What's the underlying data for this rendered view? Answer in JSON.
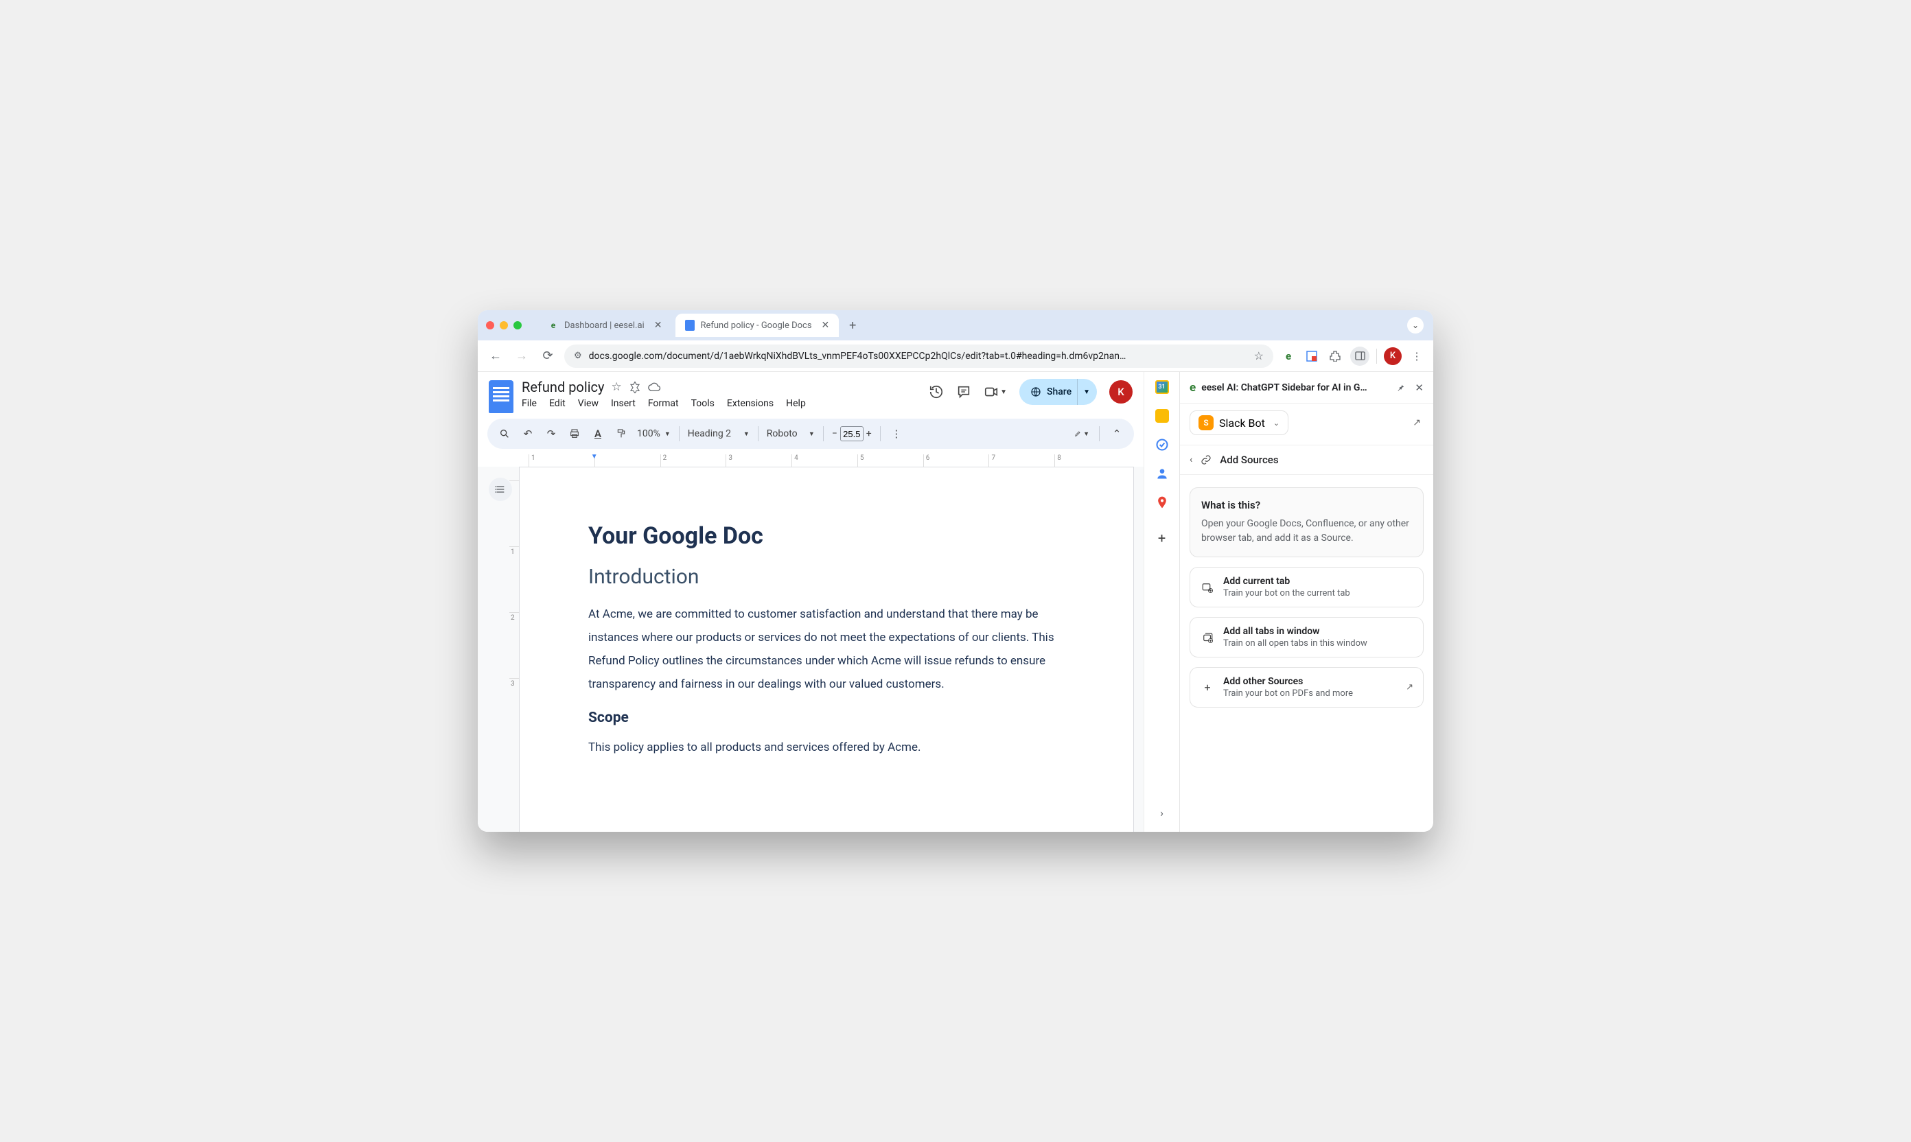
{
  "tabs": [
    {
      "title": "Dashboard | eesel.ai",
      "active": false
    },
    {
      "title": "Refund policy - Google Docs",
      "active": true
    }
  ],
  "url": "docs.google.com/document/d/1aebWrkqNiXhdBVLts_vnmPEF4oTs00XXEPCCp2hQlCs/edit?tab=t.0#heading=h.dm6vp2nan…",
  "avatar_letter": "K",
  "docs": {
    "title": "Refund policy",
    "menus": [
      "File",
      "Edit",
      "View",
      "Insert",
      "Format",
      "Tools",
      "Extensions",
      "Help"
    ],
    "share_label": "Share",
    "toolbar": {
      "zoom": "100%",
      "style": "Heading 2",
      "font": "Roboto",
      "fontsize": "25.5"
    },
    "ruler": [
      "1",
      "",
      "2",
      "3",
      "4",
      "5",
      "6",
      "7",
      "8"
    ],
    "vruler": [
      "",
      "1",
      "2",
      "3"
    ],
    "doc": {
      "h1": "Your Google Doc",
      "h2": "Introduction",
      "p1": "At Acme, we are committed to customer satisfaction and understand that there may be instances where our products or services do not meet the expectations of our clients. This Refund Policy outlines the circumstances under which Acme will issue refunds to ensure transparency and fairness in our dealings with our valued customers.",
      "h3": "Scope",
      "p2": "This policy applies to all products and services offered by Acme."
    }
  },
  "panel": {
    "title": "eesel AI: ChatGPT Sidebar for AI in G…",
    "agent": "Slack Bot",
    "agent_initial": "S",
    "breadcrumb": "Add Sources",
    "info": {
      "title": "What is this?",
      "desc": "Open your Google Docs, Confluence, or any other browser tab, and add it as a Source."
    },
    "actions": [
      {
        "title": "Add current tab",
        "desc": "Train your bot on the current tab",
        "icon": "tab",
        "arrow": false
      },
      {
        "title": "Add all tabs in window",
        "desc": "Train on all open tabs in this window",
        "icon": "tabs",
        "arrow": false
      },
      {
        "title": "Add other Sources",
        "desc": "Train your bot on PDFs and more",
        "icon": "plus",
        "arrow": true
      }
    ]
  }
}
